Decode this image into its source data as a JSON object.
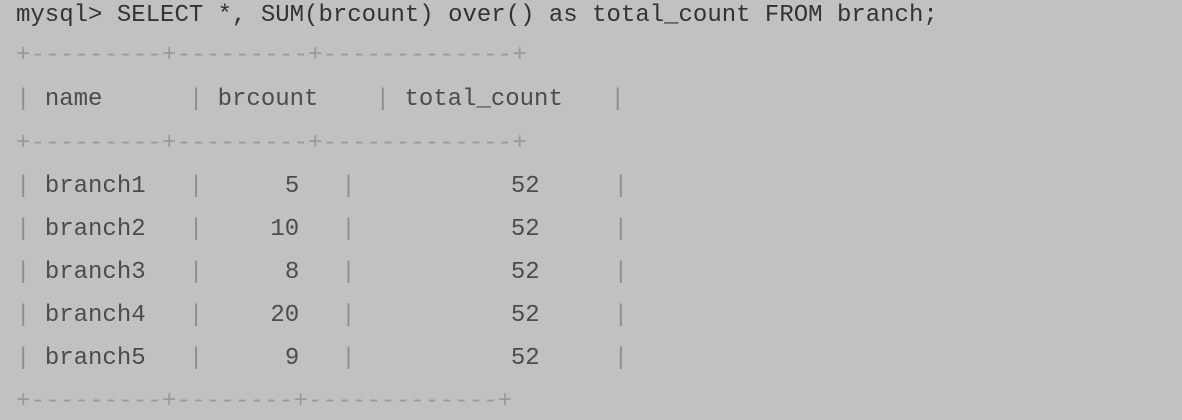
{
  "prompt": "mysql>",
  "command": "SELECT *, SUM(brcount) over() as total_count FROM branch;",
  "border_top": "+---------+---------+-------------+",
  "border_mid": "+---------+---------+-------------+",
  "border_bottom": "+---------+--------+-------------+",
  "columns": [
    "name",
    "brcount",
    "total_count"
  ],
  "rows": [
    {
      "name": "branch1",
      "brcount": "5",
      "total_count": "52"
    },
    {
      "name": "branch2",
      "brcount": "10",
      "total_count": "52"
    },
    {
      "name": "branch3",
      "brcount": "8",
      "total_count": "52"
    },
    {
      "name": "branch4",
      "brcount": "20",
      "total_count": "52"
    },
    {
      "name": "branch5",
      "brcount": "9",
      "total_count": "52"
    }
  ]
}
